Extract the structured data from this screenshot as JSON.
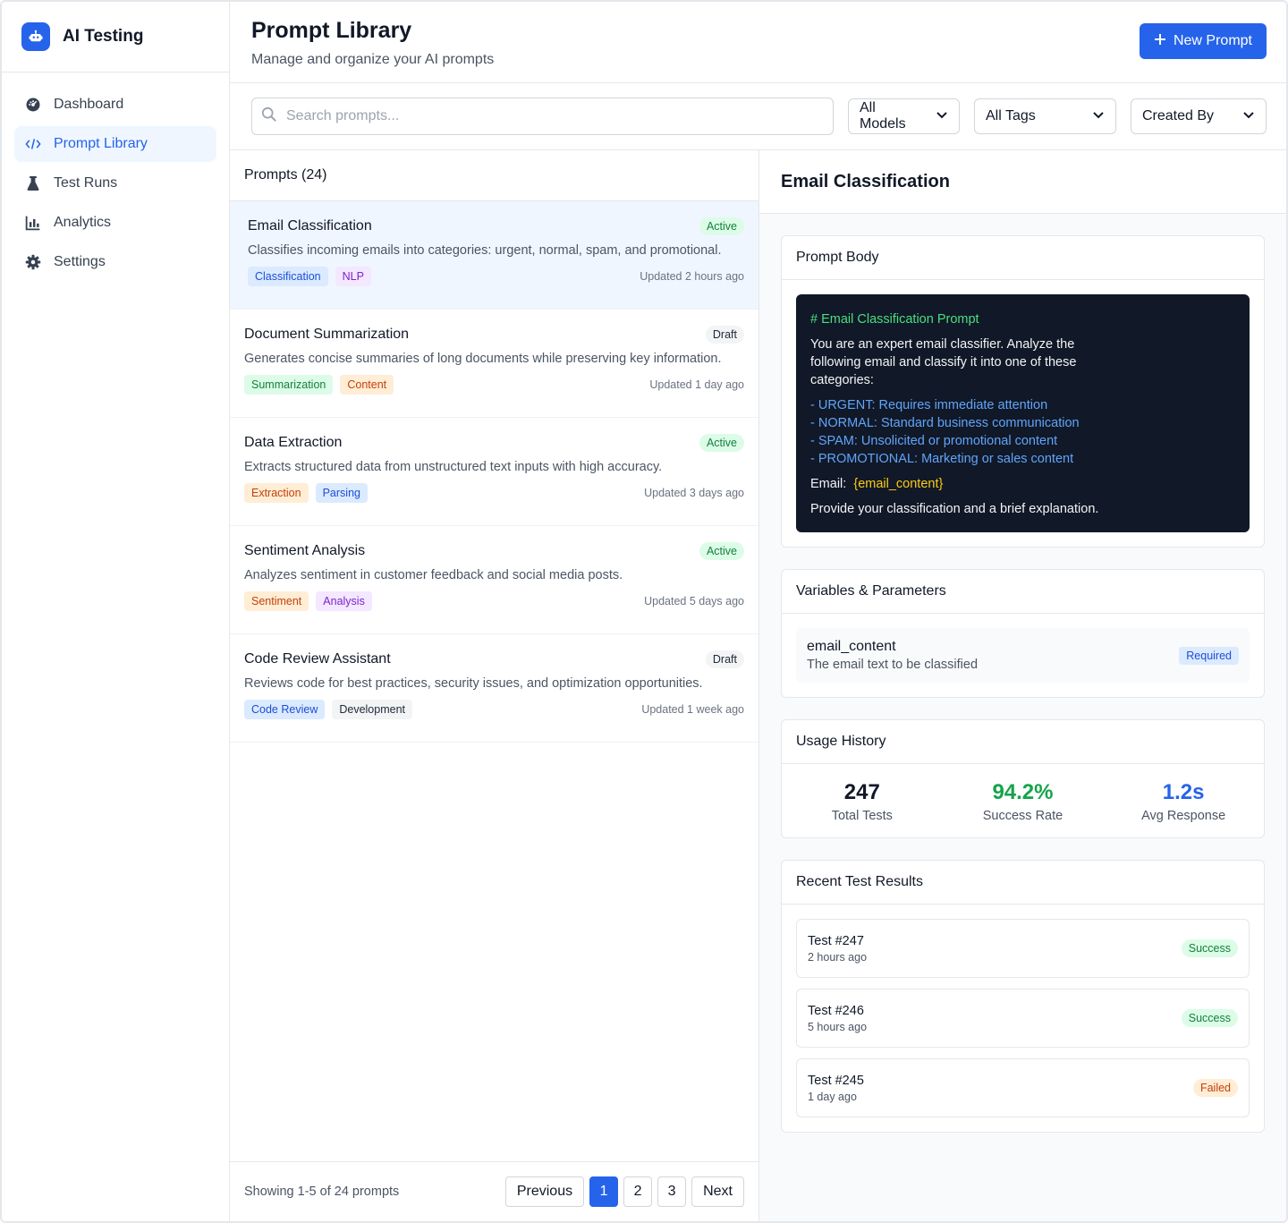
{
  "brand": {
    "title": "AI Testing"
  },
  "nav": [
    {
      "label": "Dashboard",
      "icon": "dashboard-icon"
    },
    {
      "label": "Prompt Library",
      "icon": "code-icon",
      "active": true
    },
    {
      "label": "Test Runs",
      "icon": "flask-icon"
    },
    {
      "label": "Analytics",
      "icon": "chart-icon"
    },
    {
      "label": "Settings",
      "icon": "gear-icon"
    }
  ],
  "header": {
    "title": "Prompt Library",
    "subtitle": "Manage and organize your AI prompts",
    "new_button": "New Prompt"
  },
  "filters": {
    "search_placeholder": "Search prompts...",
    "models": "All Models",
    "tags": "All Tags",
    "created_by": "Created By"
  },
  "list": {
    "header": "Prompts (24)",
    "items": [
      {
        "title": "Email Classification",
        "status": "Active",
        "desc": "Classifies incoming emails into categories: urgent, normal, spam, and promotional.",
        "tags": [
          "Classification",
          "NLP"
        ],
        "updated": "Updated 2 hours ago"
      },
      {
        "title": "Document Summarization",
        "status": "Draft",
        "desc": "Generates concise summaries of long documents while preserving key information.",
        "tags": [
          "Summarization",
          "Content"
        ],
        "updated": "Updated 1 day ago"
      },
      {
        "title": "Data Extraction",
        "status": "Active",
        "desc": "Extracts structured data from unstructured text inputs with high accuracy.",
        "tags": [
          "Extraction",
          "Parsing"
        ],
        "updated": "Updated 3 days ago"
      },
      {
        "title": "Sentiment Analysis",
        "status": "Active",
        "desc": "Analyzes sentiment in customer feedback and social media posts.",
        "tags": [
          "Sentiment",
          "Analysis"
        ],
        "updated": "Updated 5 days ago"
      },
      {
        "title": "Code Review Assistant",
        "status": "Draft",
        "desc": "Reviews code for best practices, security issues, and optimization opportunities.",
        "tags": [
          "Code Review",
          "Development"
        ],
        "updated": "Updated 1 week ago"
      }
    ],
    "pager": {
      "info": "Showing 1-5 of 24 prompts",
      "previous": "Previous",
      "pages": [
        "1",
        "2",
        "3"
      ],
      "next": "Next"
    }
  },
  "detail": {
    "title": "Email Classification",
    "prompt_body": {
      "heading": "Prompt Body",
      "comment": "# Email Classification Prompt",
      "intro_1": "You are an expert email classifier. Analyze the",
      "intro_2": "following email and classify it into one of these",
      "intro_3": "categories:",
      "categories": [
        "- URGENT: Requires immediate attention",
        "- NORMAL: Standard business communication",
        "- SPAM: Unsolicited or promotional content",
        "- PROMOTIONAL: Marketing or sales content"
      ],
      "email_label": "Email:",
      "email_var": "{email_content}",
      "closing": "Provide your classification and a brief explanation."
    },
    "variables": {
      "heading": "Variables & Parameters",
      "name": "email_content",
      "desc": "The email text to be classified",
      "badge": "Required"
    },
    "usage": {
      "heading": "Usage History",
      "total": "247",
      "total_label": "Total Tests",
      "success": "94.2%",
      "success_label": "Success Rate",
      "avg": "1.2s",
      "avg_label": "Avg Response"
    },
    "results": {
      "heading": "Recent Test Results",
      "items": [
        {
          "name": "Test #247",
          "time": "2 hours ago",
          "status": "Success"
        },
        {
          "name": "Test #246",
          "time": "5 hours ago",
          "status": "Success"
        },
        {
          "name": "Test #245",
          "time": "1 day ago",
          "status": "Failed"
        }
      ]
    }
  },
  "colors": {
    "accent": "#2563eb",
    "success": "#16a34a",
    "code_bg": "#111827"
  }
}
